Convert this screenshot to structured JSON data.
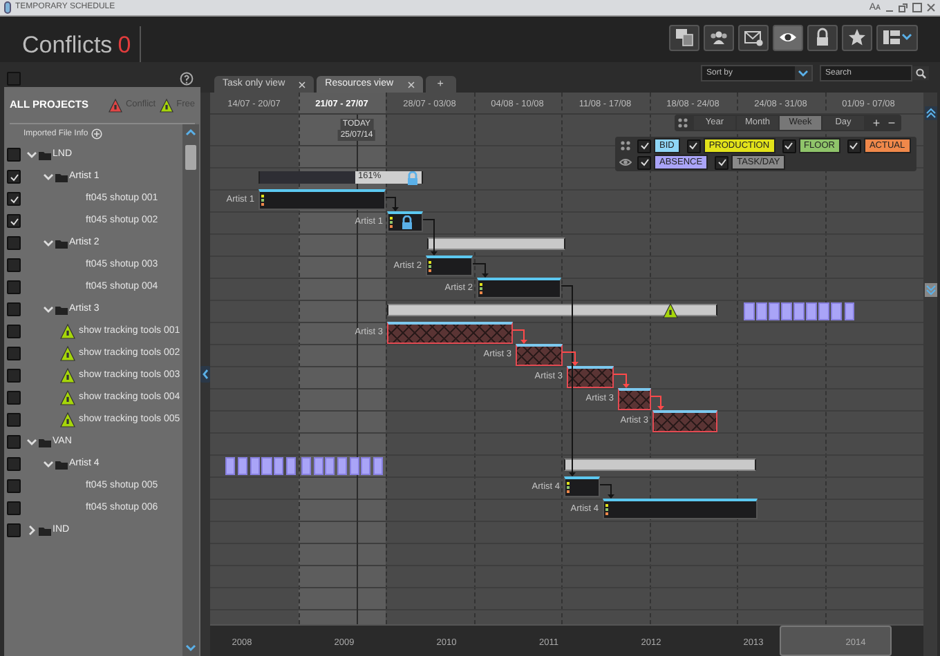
{
  "window": {
    "title": "TEMPORARY SCHEDULE",
    "font_button": "Aᴀ"
  },
  "header": {
    "title": "Conflicts",
    "count": "0"
  },
  "toolbar": [
    {
      "selected": false
    },
    {
      "selected": false
    },
    {
      "selected": false
    },
    {
      "selected": true
    },
    {
      "selected": false
    },
    {
      "selected": false
    },
    {
      "selected": false
    }
  ],
  "sort": {
    "placeholder": "Sort by"
  },
  "search": {
    "placeholder": "Search"
  },
  "sidebar": {
    "title": "ALL PROJECTS",
    "all_checked": false,
    "legend": [
      {
        "label": "Conflict",
        "kind": "conflict"
      },
      {
        "label": "Free",
        "kind": "free"
      }
    ],
    "file_info": "Imported File Info",
    "tree": [
      {
        "label": "LND",
        "kind": "folder",
        "checked": false,
        "expanded": true,
        "children": [
          {
            "label": "Artist 1",
            "kind": "folder",
            "checked": true,
            "expanded": true,
            "children": [
              {
                "label": "ft045 shotup 001",
                "kind": "task",
                "checked": true,
                "free": false
              },
              {
                "label": "ft045 shotup 002",
                "kind": "task",
                "checked": true,
                "free": false
              }
            ]
          },
          {
            "label": "Artist 2",
            "kind": "folder",
            "checked": false,
            "expanded": true,
            "children": [
              {
                "label": "ft045 shotup 003",
                "kind": "task",
                "checked": false,
                "free": false
              },
              {
                "label": "ft045 shotup 004",
                "kind": "task",
                "checked": false,
                "free": false
              }
            ]
          },
          {
            "label": "Artist 3",
            "kind": "folder",
            "checked": false,
            "expanded": true,
            "children": [
              {
                "label": "show tracking tools 001",
                "kind": "task",
                "checked": false,
                "free": true
              },
              {
                "label": "show tracking tools 002",
                "kind": "task",
                "checked": false,
                "free": true
              },
              {
                "label": "show tracking tools 003",
                "kind": "task",
                "checked": false,
                "free": true
              },
              {
                "label": "show tracking tools 004",
                "kind": "task",
                "checked": false,
                "free": true
              },
              {
                "label": "show tracking tools 005",
                "kind": "task",
                "checked": false,
                "free": true
              }
            ]
          }
        ]
      },
      {
        "label": "VAN",
        "kind": "folder",
        "checked": false,
        "expanded": true,
        "children": [
          {
            "label": "Artist 4",
            "kind": "folder",
            "checked": false,
            "expanded": true,
            "children": [
              {
                "label": "ft045 shotup 005",
                "kind": "task",
                "checked": false,
                "free": false
              },
              {
                "label": "ft045 shotup 006",
                "kind": "task",
                "checked": false,
                "free": false
              }
            ]
          }
        ]
      },
      {
        "label": "IND",
        "kind": "folder",
        "checked": false,
        "expanded": false
      }
    ]
  },
  "tabs": [
    {
      "label": "Task only view",
      "selected": false
    },
    {
      "label": "Resources view",
      "selected": true
    }
  ],
  "add_tab": "+",
  "weeks": [
    {
      "label": "14/07 - 20/07",
      "current": false
    },
    {
      "label": "21/07 - 27/07",
      "current": true
    },
    {
      "label": "28/07 - 03/08",
      "current": false
    },
    {
      "label": "04/08 - 10/08",
      "current": false
    },
    {
      "label": "11/08 - 17/08",
      "current": false
    },
    {
      "label": "18/08 - 24/08",
      "current": false
    },
    {
      "label": "24/08 - 31/08",
      "current": false
    },
    {
      "label": "01/09 - 07/08",
      "current": false
    }
  ],
  "today": {
    "label": "TODAY",
    "date": "25/07/14"
  },
  "zoom": {
    "options": [
      {
        "label": "Year",
        "selected": false
      },
      {
        "label": "Month",
        "selected": false
      },
      {
        "label": "Week",
        "selected": true
      },
      {
        "label": "Day",
        "selected": false
      }
    ],
    "plus": "+",
    "minus": "−"
  },
  "filters": [
    {
      "label": "BID",
      "checked": true,
      "color": "#8fd6f6"
    },
    {
      "label": "PRODUCTION",
      "checked": true,
      "color": "#e2e21a"
    },
    {
      "label": "FLOOR",
      "checked": true,
      "color": "#8fc46a"
    },
    {
      "label": "ACTUAL",
      "checked": true,
      "color": "#f0884a"
    },
    {
      "label": "ABSENCE",
      "checked": true,
      "color": "#aaa4f8"
    },
    {
      "label": "TASK/DAY",
      "checked": true,
      "color": "#8a8a8a"
    }
  ],
  "bars": [
    {
      "kind": "summary",
      "reading": "161%",
      "locked": true,
      "free": false
    },
    {
      "kind": "task",
      "label": "Artist 1"
    },
    {
      "kind": "task",
      "label": "Artist 1",
      "locked": true
    },
    {
      "kind": "summary",
      "free": false
    },
    {
      "kind": "task",
      "label": "Artist 2"
    },
    {
      "kind": "task",
      "label": "Artist 2"
    },
    {
      "kind": "summary",
      "free": true
    },
    {
      "kind": "absence"
    },
    {
      "kind": "conflict",
      "label": "Artist 3"
    },
    {
      "kind": "conflict",
      "label": "Artist 3"
    },
    {
      "kind": "conflict",
      "label": "Artist 3"
    },
    {
      "kind": "conflict",
      "label": "Artist 3"
    },
    {
      "kind": "conflict",
      "label": "Artist 3"
    },
    {
      "kind": "absence"
    },
    {
      "kind": "absence"
    },
    {
      "kind": "summary",
      "free": false
    },
    {
      "kind": "task",
      "label": "Artist 4"
    },
    {
      "kind": "task",
      "label": "Artist 4"
    }
  ],
  "overview": {
    "years": [
      "2008",
      "2009",
      "2010",
      "2011",
      "2012",
      "2013",
      "2014"
    ]
  }
}
